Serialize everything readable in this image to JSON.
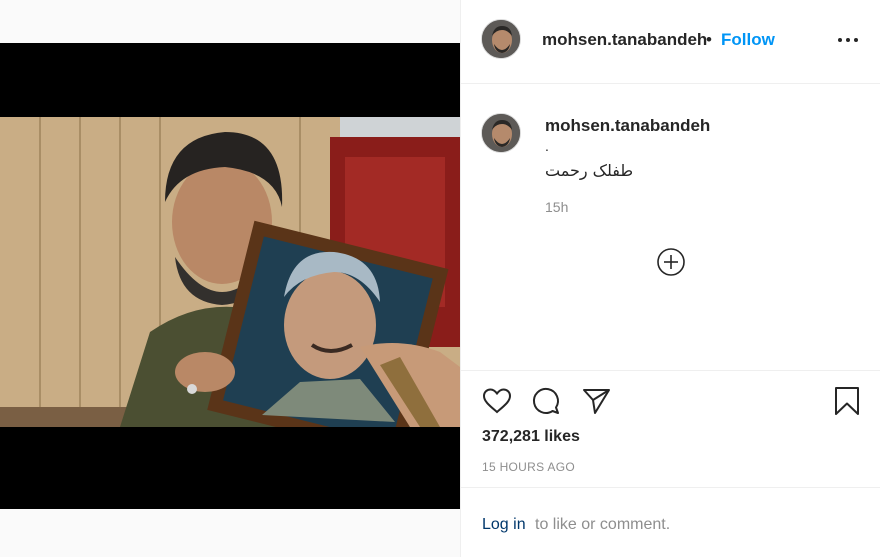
{
  "post": {
    "username": "mohsen.tanabandeh",
    "follow_separator": "•",
    "follow_label": "Follow",
    "caption_dot": ".",
    "caption_text": "طفلک رحمت",
    "caption_time": "15h",
    "likes": "372,281 likes",
    "time_ago": "15 HOURS AGO"
  },
  "login_bar": {
    "login_label": "Log in",
    "prompt_text": "to like or comment."
  },
  "icons": {
    "more": "more-options-icon",
    "load_more": "plus-circle-icon",
    "like": "heart-icon",
    "comment": "speech-bubble-icon",
    "share": "paper-plane-icon",
    "save": "bookmark-icon"
  },
  "colors": {
    "link_blue": "#0095f6",
    "login_link": "#00376b",
    "muted_text": "#8e8e8e",
    "divider": "#efefef"
  }
}
